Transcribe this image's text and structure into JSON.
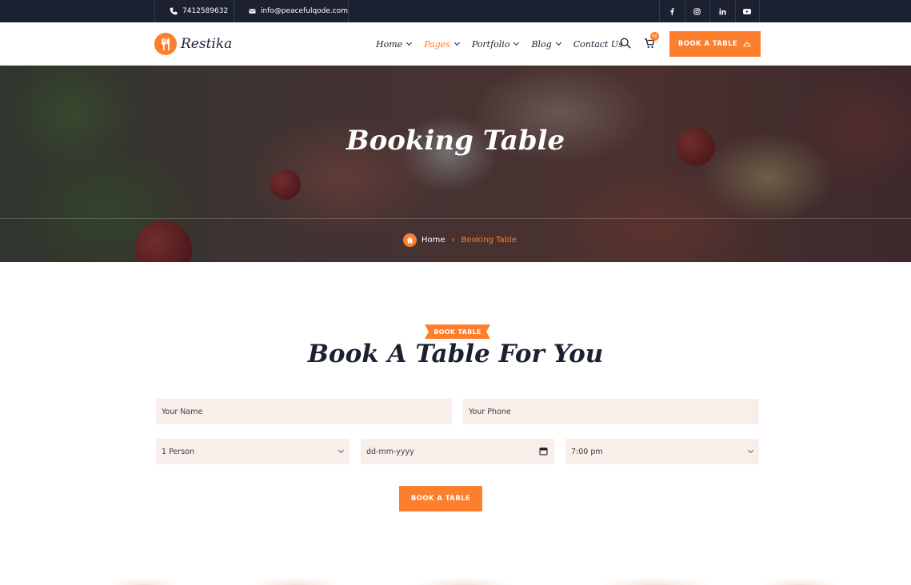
{
  "topbar": {
    "phone": "7412589632",
    "email": "info@peacefulqode.com",
    "social": [
      "facebook-icon",
      "instagram-icon",
      "linkedin-icon",
      "youtube-icon"
    ]
  },
  "header": {
    "logo_text": "Restika",
    "nav": [
      {
        "label": "Home",
        "dropdown": true,
        "active": false
      },
      {
        "label": "Pages",
        "dropdown": true,
        "active": true
      },
      {
        "label": "Portfolio",
        "dropdown": true,
        "active": false
      },
      {
        "label": "Blog",
        "dropdown": true,
        "active": false
      },
      {
        "label": "Contact Us",
        "dropdown": false,
        "active": false
      }
    ],
    "cart_count": "00",
    "cta_label": "BOOK A TABLE"
  },
  "hero": {
    "title": "Booking Table",
    "breadcrumb_home": "Home",
    "breadcrumb_current": "Booking Table"
  },
  "booking": {
    "tag": "BOOK TABLE",
    "title": "Book A Table For You",
    "name_placeholder": "Your Name",
    "phone_placeholder": "Your Phone",
    "persons_value": "1 Person",
    "date_placeholder": "dd-mm-yyyy",
    "time_value": "7:00 pm",
    "submit_label": "BOOK A TABLE"
  },
  "colors": {
    "accent": "#fd7e2d",
    "dark": "#1c2132",
    "field_bg": "#f8efea"
  }
}
